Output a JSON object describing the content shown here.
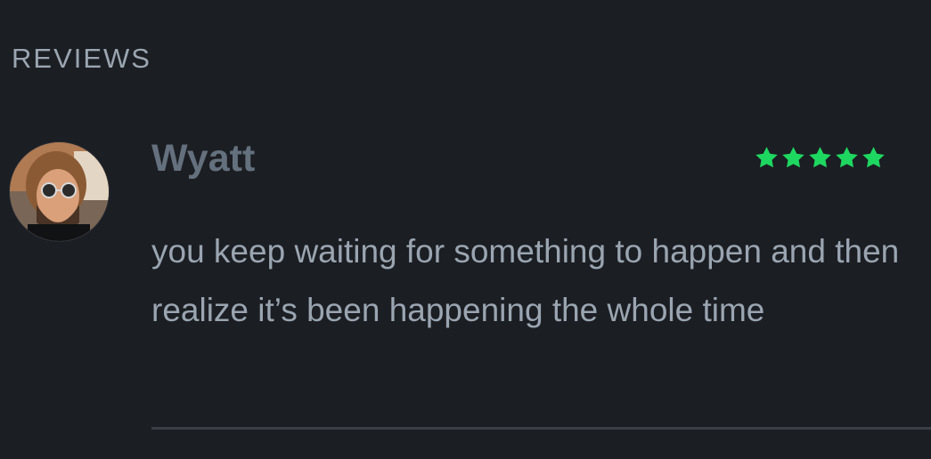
{
  "section": {
    "title": "REVIEWS"
  },
  "review": {
    "reviewer_name": "Wyatt",
    "rating": 5,
    "rating_max": 5,
    "text": "you keep waiting for something to happen and then realize it’s been happening the whole time",
    "avatar_icon": "user-avatar-photo"
  },
  "colors": {
    "background": "#1b1e23",
    "star": "#1ed760",
    "name": "#64707d",
    "text": "#9aa5b1",
    "divider": "#3a3f46"
  }
}
